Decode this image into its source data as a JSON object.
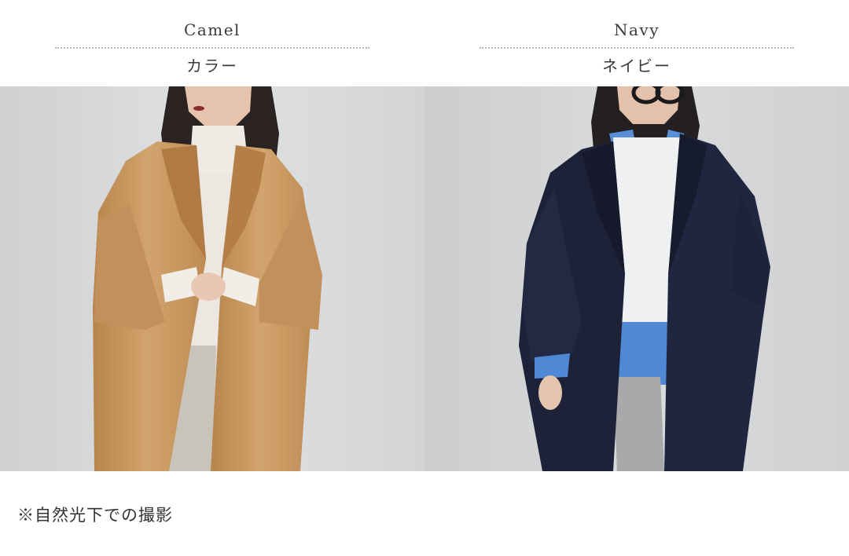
{
  "colors": [
    {
      "name_en": "Camel",
      "name_jp": "カラー",
      "coat_hex": "#c99a63"
    },
    {
      "name_en": "Navy",
      "name_jp": "ネイビー",
      "coat_hex": "#1f2440"
    }
  ],
  "divider_color": "#b5b5b5",
  "footnote": "※自然光下での撮影"
}
